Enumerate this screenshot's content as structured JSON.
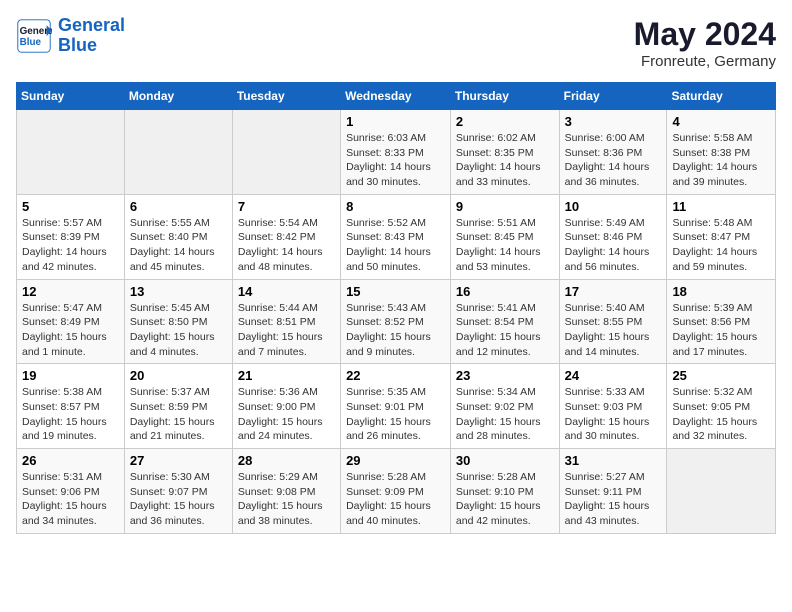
{
  "header": {
    "logo_line1": "General",
    "logo_line2": "Blue",
    "title": "May 2024",
    "subtitle": "Fronreute, Germany"
  },
  "weekdays": [
    "Sunday",
    "Monday",
    "Tuesday",
    "Wednesday",
    "Thursday",
    "Friday",
    "Saturday"
  ],
  "weeks": [
    [
      {
        "day": "",
        "info": ""
      },
      {
        "day": "",
        "info": ""
      },
      {
        "day": "",
        "info": ""
      },
      {
        "day": "1",
        "info": "Sunrise: 6:03 AM\nSunset: 8:33 PM\nDaylight: 14 hours\nand 30 minutes."
      },
      {
        "day": "2",
        "info": "Sunrise: 6:02 AM\nSunset: 8:35 PM\nDaylight: 14 hours\nand 33 minutes."
      },
      {
        "day": "3",
        "info": "Sunrise: 6:00 AM\nSunset: 8:36 PM\nDaylight: 14 hours\nand 36 minutes."
      },
      {
        "day": "4",
        "info": "Sunrise: 5:58 AM\nSunset: 8:38 PM\nDaylight: 14 hours\nand 39 minutes."
      }
    ],
    [
      {
        "day": "5",
        "info": "Sunrise: 5:57 AM\nSunset: 8:39 PM\nDaylight: 14 hours\nand 42 minutes."
      },
      {
        "day": "6",
        "info": "Sunrise: 5:55 AM\nSunset: 8:40 PM\nDaylight: 14 hours\nand 45 minutes."
      },
      {
        "day": "7",
        "info": "Sunrise: 5:54 AM\nSunset: 8:42 PM\nDaylight: 14 hours\nand 48 minutes."
      },
      {
        "day": "8",
        "info": "Sunrise: 5:52 AM\nSunset: 8:43 PM\nDaylight: 14 hours\nand 50 minutes."
      },
      {
        "day": "9",
        "info": "Sunrise: 5:51 AM\nSunset: 8:45 PM\nDaylight: 14 hours\nand 53 minutes."
      },
      {
        "day": "10",
        "info": "Sunrise: 5:49 AM\nSunset: 8:46 PM\nDaylight: 14 hours\nand 56 minutes."
      },
      {
        "day": "11",
        "info": "Sunrise: 5:48 AM\nSunset: 8:47 PM\nDaylight: 14 hours\nand 59 minutes."
      }
    ],
    [
      {
        "day": "12",
        "info": "Sunrise: 5:47 AM\nSunset: 8:49 PM\nDaylight: 15 hours\nand 1 minute."
      },
      {
        "day": "13",
        "info": "Sunrise: 5:45 AM\nSunset: 8:50 PM\nDaylight: 15 hours\nand 4 minutes."
      },
      {
        "day": "14",
        "info": "Sunrise: 5:44 AM\nSunset: 8:51 PM\nDaylight: 15 hours\nand 7 minutes."
      },
      {
        "day": "15",
        "info": "Sunrise: 5:43 AM\nSunset: 8:52 PM\nDaylight: 15 hours\nand 9 minutes."
      },
      {
        "day": "16",
        "info": "Sunrise: 5:41 AM\nSunset: 8:54 PM\nDaylight: 15 hours\nand 12 minutes."
      },
      {
        "day": "17",
        "info": "Sunrise: 5:40 AM\nSunset: 8:55 PM\nDaylight: 15 hours\nand 14 minutes."
      },
      {
        "day": "18",
        "info": "Sunrise: 5:39 AM\nSunset: 8:56 PM\nDaylight: 15 hours\nand 17 minutes."
      }
    ],
    [
      {
        "day": "19",
        "info": "Sunrise: 5:38 AM\nSunset: 8:57 PM\nDaylight: 15 hours\nand 19 minutes."
      },
      {
        "day": "20",
        "info": "Sunrise: 5:37 AM\nSunset: 8:59 PM\nDaylight: 15 hours\nand 21 minutes."
      },
      {
        "day": "21",
        "info": "Sunrise: 5:36 AM\nSunset: 9:00 PM\nDaylight: 15 hours\nand 24 minutes."
      },
      {
        "day": "22",
        "info": "Sunrise: 5:35 AM\nSunset: 9:01 PM\nDaylight: 15 hours\nand 26 minutes."
      },
      {
        "day": "23",
        "info": "Sunrise: 5:34 AM\nSunset: 9:02 PM\nDaylight: 15 hours\nand 28 minutes."
      },
      {
        "day": "24",
        "info": "Sunrise: 5:33 AM\nSunset: 9:03 PM\nDaylight: 15 hours\nand 30 minutes."
      },
      {
        "day": "25",
        "info": "Sunrise: 5:32 AM\nSunset: 9:05 PM\nDaylight: 15 hours\nand 32 minutes."
      }
    ],
    [
      {
        "day": "26",
        "info": "Sunrise: 5:31 AM\nSunset: 9:06 PM\nDaylight: 15 hours\nand 34 minutes."
      },
      {
        "day": "27",
        "info": "Sunrise: 5:30 AM\nSunset: 9:07 PM\nDaylight: 15 hours\nand 36 minutes."
      },
      {
        "day": "28",
        "info": "Sunrise: 5:29 AM\nSunset: 9:08 PM\nDaylight: 15 hours\nand 38 minutes."
      },
      {
        "day": "29",
        "info": "Sunrise: 5:28 AM\nSunset: 9:09 PM\nDaylight: 15 hours\nand 40 minutes."
      },
      {
        "day": "30",
        "info": "Sunrise: 5:28 AM\nSunset: 9:10 PM\nDaylight: 15 hours\nand 42 minutes."
      },
      {
        "day": "31",
        "info": "Sunrise: 5:27 AM\nSunset: 9:11 PM\nDaylight: 15 hours\nand 43 minutes."
      },
      {
        "day": "",
        "info": ""
      }
    ]
  ]
}
